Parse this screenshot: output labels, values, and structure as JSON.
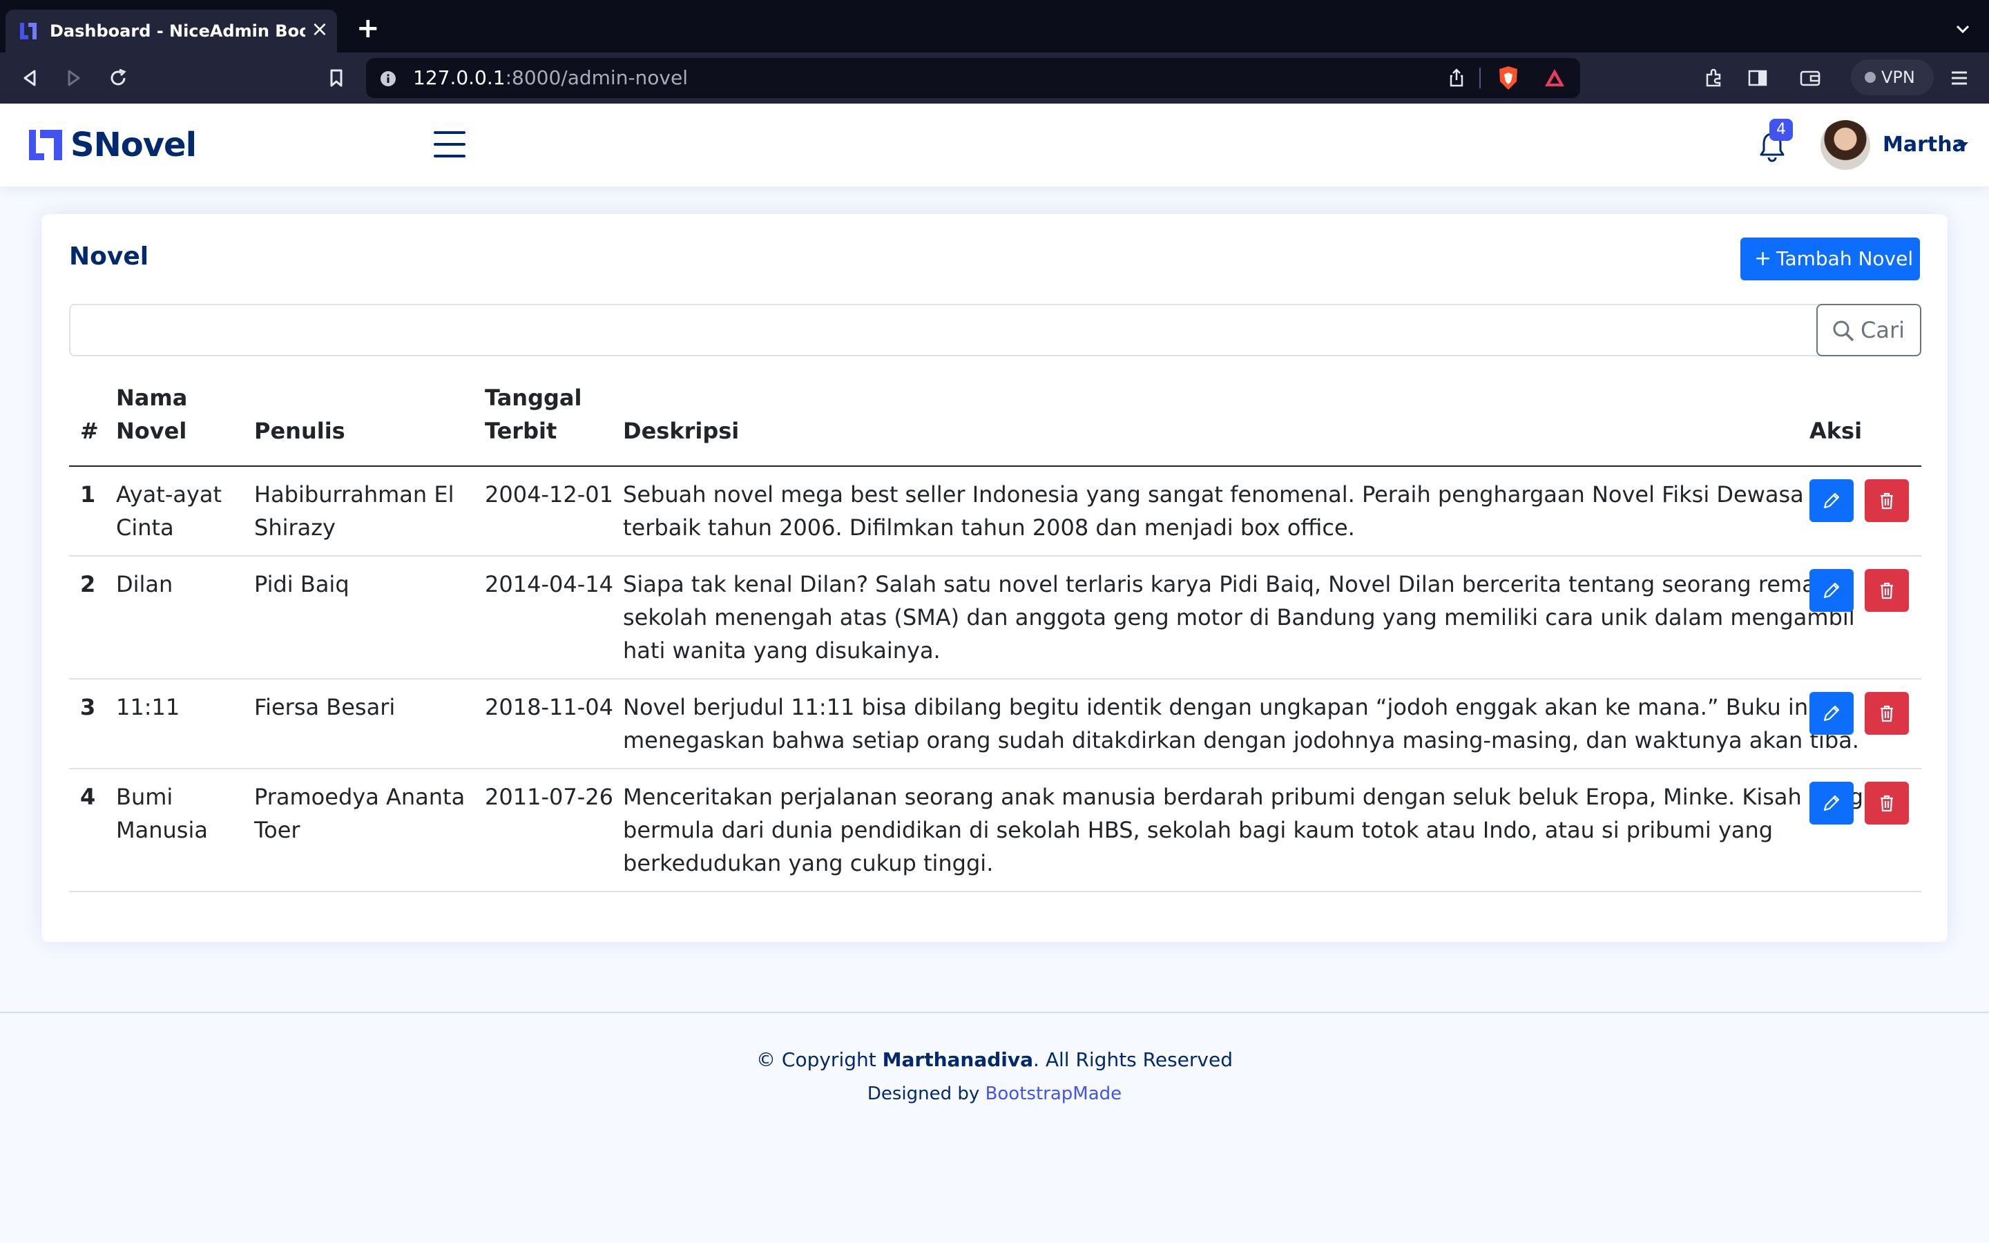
{
  "browser": {
    "tab_title": "Dashboard - NiceAdmin Bootstrap Template",
    "url_host": "127.0.0.1",
    "url_path": ":8000/admin-novel",
    "vpn_label": "VPN"
  },
  "header": {
    "logo_text": "SNovel",
    "notification_count": "4",
    "username": "Martha"
  },
  "card": {
    "title": "Novel",
    "add_button": "Tambah Novel",
    "search_value": "",
    "search_button": "Cari"
  },
  "table": {
    "headers": {
      "num": "#",
      "nama_1": "Nama",
      "nama_2": "Novel",
      "penulis": "Penulis",
      "tanggal_1": "Tanggal",
      "tanggal_2": "Terbit",
      "deskripsi": "Deskripsi",
      "aksi": "Aksi"
    },
    "rows": [
      {
        "num": "1",
        "nama": [
          "Ayat-ayat",
          "Cinta"
        ],
        "penulis": [
          "Habiburrahman El",
          "Shirazy"
        ],
        "tanggal": "2004-12-01",
        "deskripsi": [
          "Sebuah novel mega best seller Indonesia yang sangat fenomenal. Peraih penghargaan Novel Fiksi Dewasa",
          "terbaik tahun 2006. Difilmkan tahun 2008 dan menjadi box office."
        ]
      },
      {
        "num": "2",
        "nama": [
          "Dilan"
        ],
        "penulis": [
          "Pidi Baiq"
        ],
        "tanggal": "2014-04-14",
        "deskripsi": [
          "Siapa tak kenal Dilan? Salah satu novel terlaris karya Pidi Baiq, Novel Dilan bercerita tentang seorang remaja",
          "sekolah menengah atas (SMA) dan anggota geng motor di Bandung yang memiliki cara unik dalam mengambil",
          "hati wanita yang disukainya."
        ]
      },
      {
        "num": "3",
        "nama": [
          "11:11"
        ],
        "penulis": [
          "Fiersa Besari"
        ],
        "tanggal": "2018-11-04",
        "deskripsi": [
          "Novel berjudul 11:11 bisa dibilang begitu identik dengan ungkapan “jodoh enggak akan ke mana.” Buku ini",
          "menegaskan bahwa setiap orang sudah ditakdirkan dengan jodohnya masing-masing, dan waktunya akan tiba."
        ]
      },
      {
        "num": "4",
        "nama": [
          "Bumi",
          "Manusia"
        ],
        "penulis": [
          "Pramoedya Ananta",
          "Toer"
        ],
        "tanggal": "2011-07-26",
        "deskripsi": [
          "Menceritakan perjalanan seorang anak manusia berdarah pribumi dengan seluk beluk Eropa, Minke. Kisah yang",
          "bermula dari dunia pendidikan di sekolah HBS, sekolah bagi kaum totok atau Indo, atau si pribumi yang",
          "berkedudukan yang cukup tinggi."
        ]
      }
    ]
  },
  "footer": {
    "copyright_prefix": "© Copyright ",
    "copyright_name": "Marthanadiva",
    "copyright_suffix": ". All Rights Reserved",
    "designed_by": "Designed by ",
    "designer": "BootstrapMade"
  },
  "colors": {
    "brand": "#012970",
    "primary": "#0d6efd",
    "danger": "#dc3545",
    "badge": "#4154f1"
  }
}
